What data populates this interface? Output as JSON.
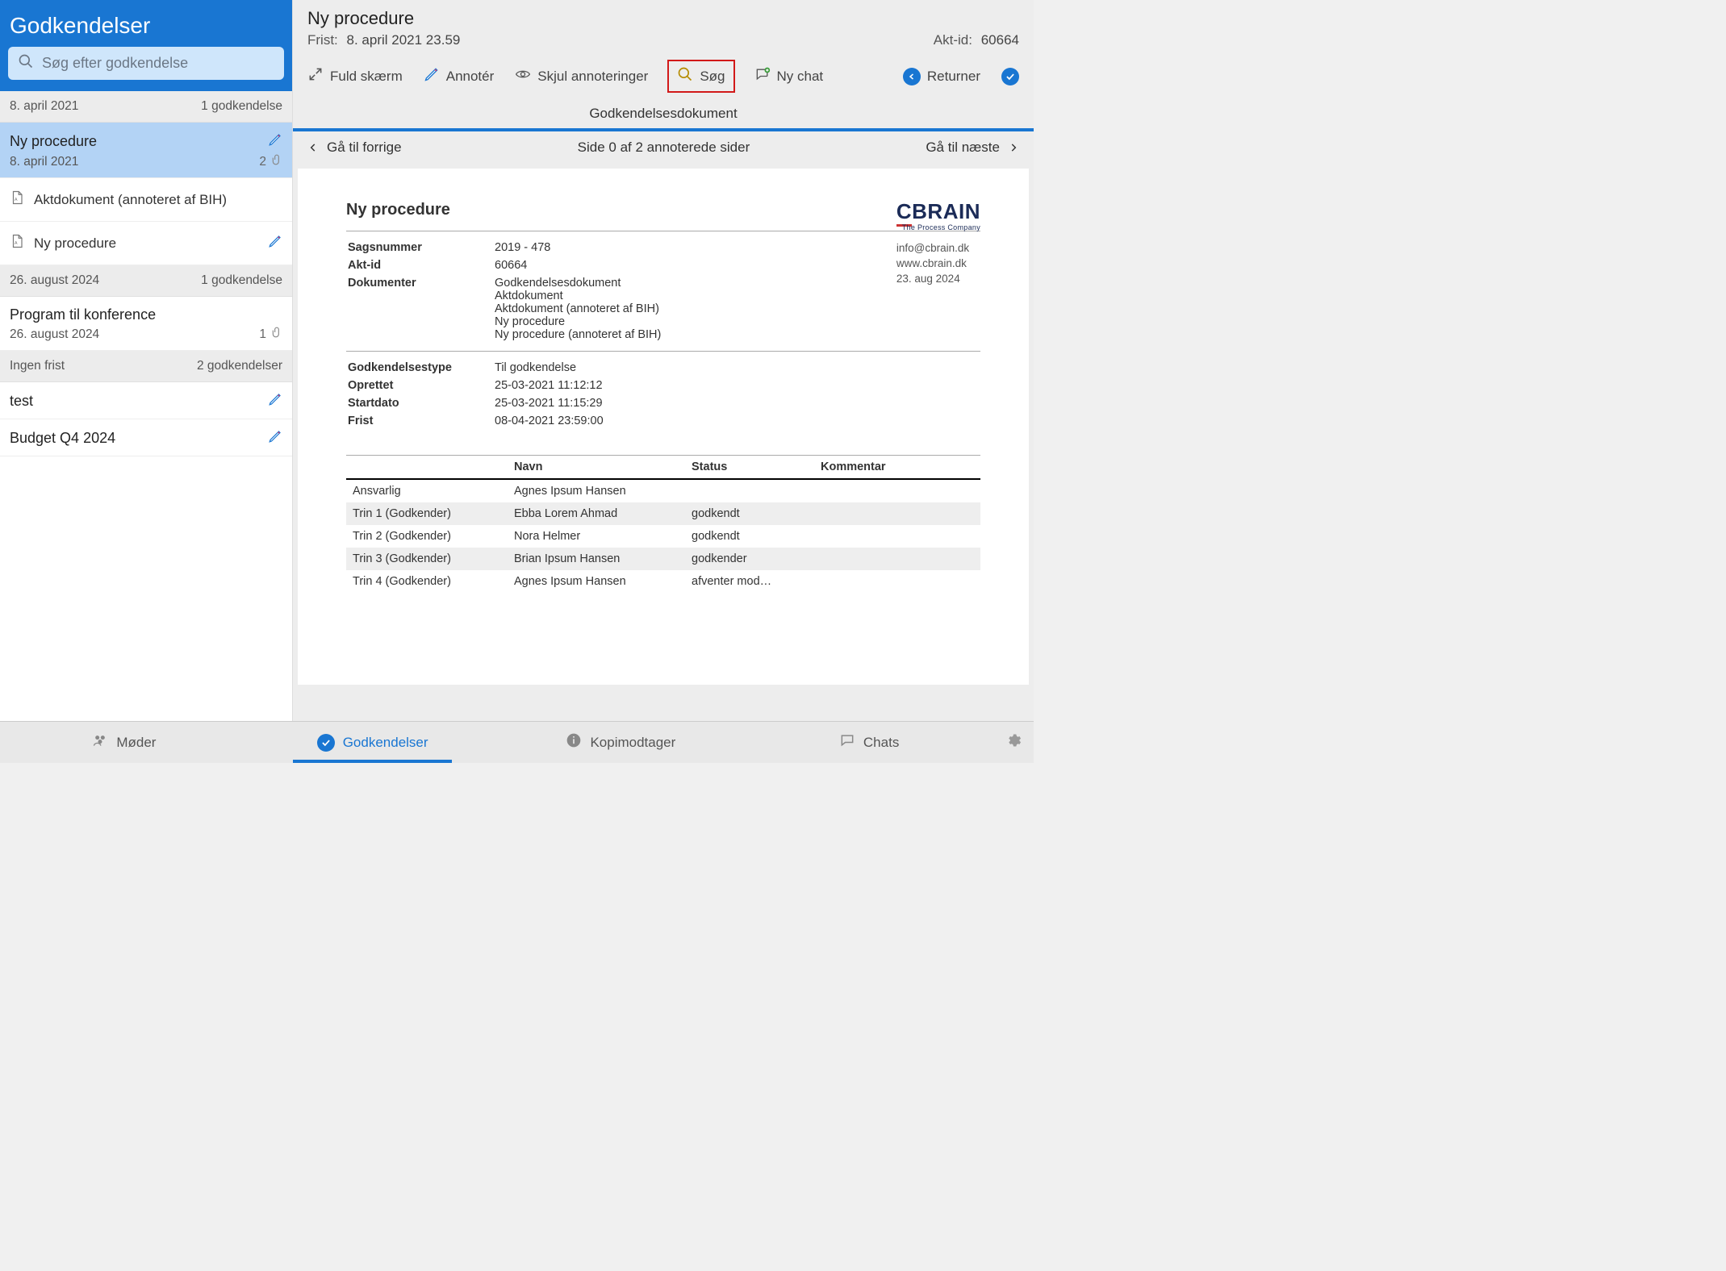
{
  "sidebar": {
    "title": "Godkendelser",
    "search_placeholder": "Søg efter godkendelse",
    "groups": [
      {
        "label": "8. april 2021",
        "count_label": "1 godkendelse",
        "items": [
          {
            "title": "Ny procedure",
            "date": "8. april 2021",
            "attachment_count": "2",
            "has_pencil": true,
            "has_clip": true,
            "selected": true,
            "docs": [
              {
                "title": "Aktdokument (annoteret af BIH)",
                "has_pencil": false
              },
              {
                "title": "Ny procedure",
                "has_pencil": true
              }
            ]
          }
        ]
      },
      {
        "label": "26. august 2024",
        "count_label": "1 godkendelse",
        "items": [
          {
            "title": "Program til konference",
            "date": "26. august 2024",
            "attachment_count": "1",
            "has_pencil": false,
            "has_clip": true,
            "selected": false
          }
        ]
      },
      {
        "label": "Ingen frist",
        "count_label": "2 godkendelser",
        "items": [
          {
            "title": "test",
            "has_pencil": true,
            "selected": false
          },
          {
            "title": "Budget Q4 2024",
            "has_pencil": true,
            "selected": false
          }
        ]
      }
    ]
  },
  "header": {
    "title": "Ny procedure",
    "frist_label": "Frist:",
    "frist_value": "8. april 2021 23.59",
    "aktid_label": "Akt-id:",
    "aktid_value": "60664"
  },
  "toolbar": {
    "fullscreen": "Fuld skærm",
    "annotate": "Annotér",
    "hide_annotations": "Skjul annoteringer",
    "search": "Søg",
    "new_chat": "Ny chat",
    "return": "Returner"
  },
  "doc_tab": "Godkendelsesdokument",
  "pager": {
    "prev": "Gå til forrige",
    "status": "Side 0 af 2 annoterede sider",
    "next": "Gå til næste"
  },
  "document": {
    "title": "Ny procedure",
    "company": {
      "name": "CBRAIN",
      "tagline": "The Process Company",
      "email": "info@cbrain.dk",
      "web": "www.cbrain.dk",
      "date": "23. aug 2024"
    },
    "meta1": {
      "sagsnummer_k": "Sagsnummer",
      "sagsnummer_v": "2019 - 478",
      "aktid_k": "Akt-id",
      "aktid_v": "60664",
      "dokumenter_k": "Dokumenter",
      "dokumenter_v": [
        "Godkendelsesdokument",
        "Aktdokument",
        "Aktdokument (annoteret af BIH)",
        "Ny procedure",
        "Ny procedure (annoteret af BIH)"
      ]
    },
    "meta2": {
      "type_k": "Godkendelsestype",
      "type_v": "Til godkendelse",
      "oprettet_k": "Oprettet",
      "oprettet_v": "25-03-2021 11:12:12",
      "start_k": "Startdato",
      "start_v": "25-03-2021 11:15:29",
      "frist_k": "Frist",
      "frist_v": "08-04-2021 23:59:00"
    },
    "table": {
      "headers": {
        "role": "",
        "navn": "Navn",
        "status": "Status",
        "kommentar": "Kommentar"
      },
      "rows": [
        {
          "role": "Ansvarlig",
          "navn": "Agnes Ipsum Hansen",
          "status": "",
          "alt": false
        },
        {
          "role": "Trin 1 (Godkender)",
          "navn": "Ebba Lorem Ahmad",
          "status": "godkendt",
          "alt": true
        },
        {
          "role": "Trin 2 (Godkender)",
          "navn": "Nora Helmer",
          "status": "godkendt",
          "alt": false
        },
        {
          "role": "Trin 3 (Godkender)",
          "navn": "Brian Ipsum Hansen",
          "status": "godkender",
          "alt": true
        },
        {
          "role": "Trin 4 (Godkender)",
          "navn": "Agnes Ipsum Hansen",
          "status": "afventer mod…",
          "alt": false
        }
      ]
    }
  },
  "bottom_nav": {
    "meetings": "Møder",
    "approvals": "Godkendelser",
    "copyrecipient": "Kopimodtager",
    "chats": "Chats"
  }
}
